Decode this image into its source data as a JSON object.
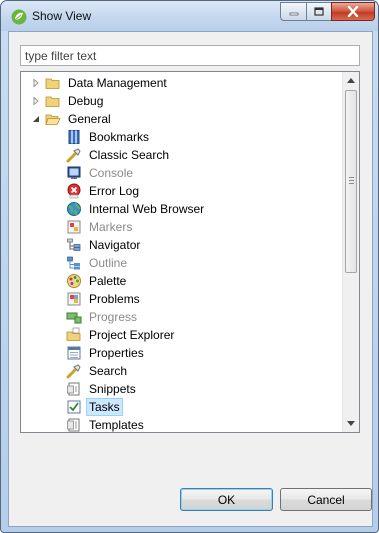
{
  "window": {
    "title": "Show View",
    "controls": {
      "minimize": "minimize",
      "maximize": "maximize",
      "close": "close"
    }
  },
  "filter": {
    "placeholder": "type filter text",
    "value": ""
  },
  "tree": {
    "items": [
      {
        "label": "Data Management",
        "type": "folder",
        "expanded": false,
        "icon": "folder-icon"
      },
      {
        "label": "Debug",
        "type": "folder",
        "expanded": false,
        "icon": "folder-icon"
      },
      {
        "label": "General",
        "type": "folder",
        "expanded": true,
        "icon": "folder-open-icon"
      },
      {
        "label": "Bookmarks",
        "type": "view",
        "icon": "bookmarks-icon"
      },
      {
        "label": "Classic Search",
        "type": "view",
        "icon": "search-flashlight-icon"
      },
      {
        "label": "Console",
        "type": "view",
        "icon": "console-icon",
        "dim": true
      },
      {
        "label": "Error Log",
        "type": "view",
        "icon": "error-log-icon"
      },
      {
        "label": "Internal Web Browser",
        "type": "view",
        "icon": "globe-icon"
      },
      {
        "label": "Markers",
        "type": "view",
        "icon": "markers-icon",
        "dim": true
      },
      {
        "label": "Navigator",
        "type": "view",
        "icon": "navigator-icon"
      },
      {
        "label": "Outline",
        "type": "view",
        "icon": "outline-icon",
        "dim": true
      },
      {
        "label": "Palette",
        "type": "view",
        "icon": "palette-icon"
      },
      {
        "label": "Problems",
        "type": "view",
        "icon": "problems-icon"
      },
      {
        "label": "Progress",
        "type": "view",
        "icon": "progress-icon",
        "dim": true
      },
      {
        "label": "Project Explorer",
        "type": "view",
        "icon": "project-explorer-icon"
      },
      {
        "label": "Properties",
        "type": "view",
        "icon": "properties-icon"
      },
      {
        "label": "Search",
        "type": "view",
        "icon": "search-flashlight-icon"
      },
      {
        "label": "Snippets",
        "type": "view",
        "icon": "snippets-icon"
      },
      {
        "label": "Tasks",
        "type": "view",
        "icon": "tasks-icon",
        "selected": true
      },
      {
        "label": "Templates",
        "type": "view",
        "icon": "templates-icon"
      }
    ]
  },
  "buttons": {
    "ok": "OK",
    "cancel": "Cancel"
  },
  "colors": {
    "selection_bg": "#cce8ff",
    "selection_border": "#99d1ff",
    "folder": "#e8c65a",
    "dim_text": "#8a8a8a"
  }
}
